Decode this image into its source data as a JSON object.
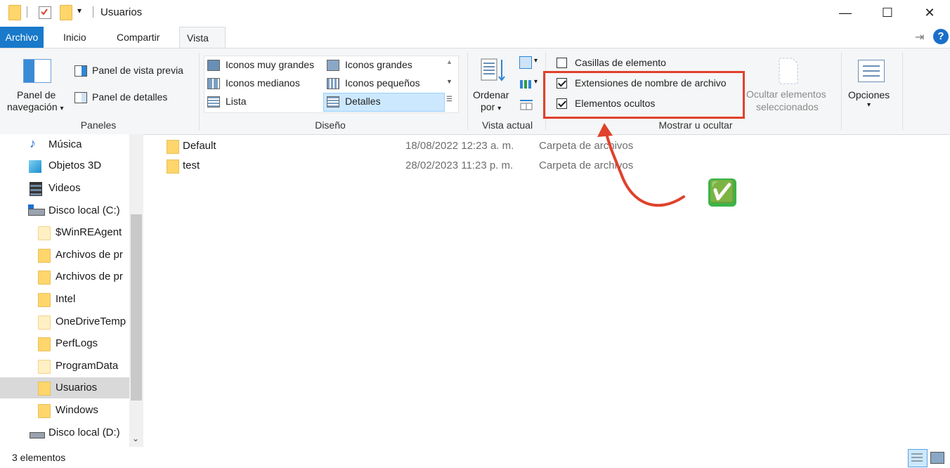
{
  "window": {
    "title": "Usuarios",
    "minimize_glyph": "—",
    "maximize_glyph": "☐",
    "close_glyph": "✕"
  },
  "tabs": [
    {
      "label": "Archivo"
    },
    {
      "label": "Inicio"
    },
    {
      "label": "Compartir"
    },
    {
      "label": "Vista"
    }
  ],
  "ribbon": {
    "pin_glyph": "⇥",
    "help_glyph": "?",
    "panels": {
      "navigation_pane_line1": "Panel de",
      "navigation_pane_line2": "navegación",
      "preview_pane": "Panel de vista previa",
      "details_pane": "Panel de detalles",
      "group_label": "Paneles"
    },
    "layout": {
      "extra_large_icons": "Iconos muy grandes",
      "large_icons": "Iconos grandes",
      "medium_icons": "Iconos medianos",
      "small_icons": "Iconos pequeños",
      "list": "Lista",
      "details": "Detalles",
      "group_label": "Diseño"
    },
    "current_view": {
      "sort_by_line1": "Ordenar",
      "sort_by_line2": "por",
      "group_label": "Vista actual"
    },
    "show_hide": {
      "item_checkboxes": "Casillas de elemento",
      "item_checkboxes_checked": false,
      "file_name_extensions": "Extensiones de nombre de archivo",
      "file_name_extensions_checked": true,
      "hidden_items": "Elementos ocultos",
      "hidden_items_checked": true,
      "hide_selected_line1": "Ocultar elementos",
      "hide_selected_line2": "seleccionados",
      "group_label": "Mostrar u ocultar"
    },
    "options": {
      "label": "Opciones"
    }
  },
  "nav": {
    "items": [
      {
        "label": "Música",
        "icon": "music-icon"
      },
      {
        "label": "Objetos 3D",
        "icon": "3d-objects-icon"
      },
      {
        "label": "Videos",
        "icon": "videos-icon"
      },
      {
        "label": "Disco local (C:)",
        "icon": "drive-icon"
      },
      {
        "label": "$WinREAgent",
        "icon": "folder-icon"
      },
      {
        "label": "Archivos de pr",
        "icon": "folder-icon"
      },
      {
        "label": "Archivos de pr",
        "icon": "folder-icon"
      },
      {
        "label": "Intel",
        "icon": "folder-icon"
      },
      {
        "label": "OneDriveTemp",
        "icon": "folder-icon"
      },
      {
        "label": "PerfLogs",
        "icon": "folder-icon"
      },
      {
        "label": "ProgramData",
        "icon": "folder-icon"
      },
      {
        "label": "Usuarios",
        "icon": "folder-icon",
        "selected": true
      },
      {
        "label": "Windows",
        "icon": "folder-icon"
      },
      {
        "label": "Disco local (D:)",
        "icon": "drive-icon"
      }
    ]
  },
  "files": [
    {
      "name": "Default",
      "date": "18/08/2022 12:23 a. m.",
      "type": "Carpeta de archivos"
    },
    {
      "name": "test",
      "date": "28/02/2023 11:23 p. m.",
      "type": "Carpeta de archivos"
    }
  ],
  "annotation": {
    "check_emoji": "✅",
    "highlight_color": "#e0412c"
  },
  "status": {
    "item_count": "3 elementos"
  },
  "colors": {
    "accent": "#1979ca",
    "ribbon_bg": "#f5f6f7",
    "selection": "#cce8ff",
    "folder": "#ffd66b"
  }
}
